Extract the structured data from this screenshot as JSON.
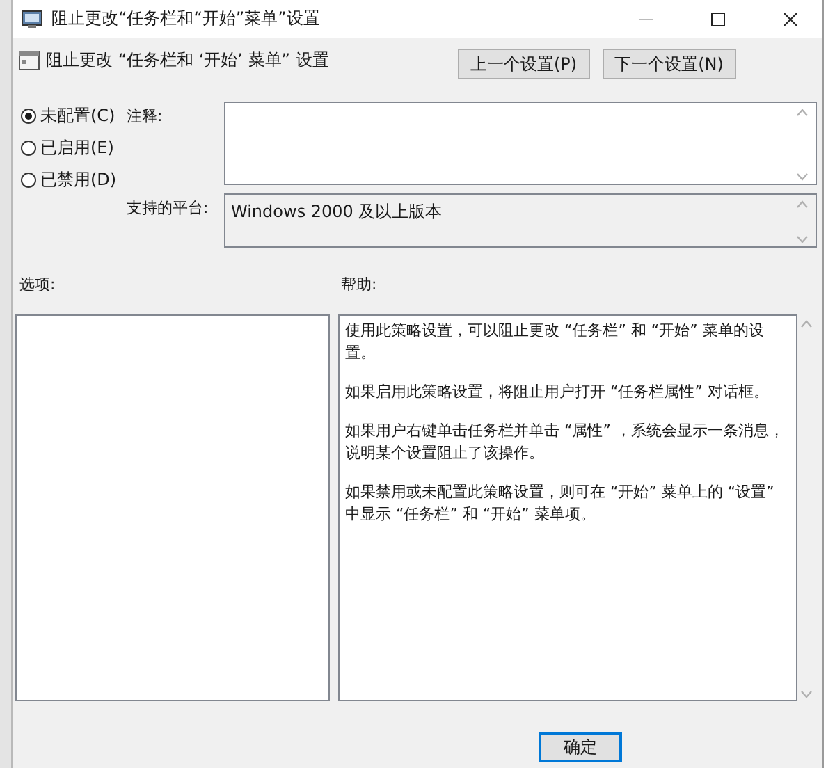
{
  "window": {
    "title": "阻止更改“任务栏和“开始”菜单”设置"
  },
  "header": {
    "policy_name": "阻止更改 “任务栏和 ‘开始’ 菜单” 设置",
    "buttons": [
      {
        "label": "上一个设置(P)"
      },
      {
        "label": "下一个设置(N)"
      }
    ]
  },
  "state_options": [
    {
      "label": "未配置(C)",
      "selected": true
    },
    {
      "label": "已启用(E)",
      "selected": false
    },
    {
      "label": "已禁用(D)",
      "selected": false
    }
  ],
  "comment": {
    "label": "注释:"
  },
  "supported_on": {
    "label": "支持的平台:",
    "value": "Windows 2000 及以上版本"
  },
  "options": {
    "label": "选项:"
  },
  "help": {
    "label": "帮助:",
    "paragraphs": [
      "使用此策略设置，可以阻止更改 “任务栏” 和 “开始” 菜单的设置。",
      "如果启用此策略设置，将阻止用户打开 “任务栏属性” 对话框。",
      "如果用户右键单击任务栏并单击 “属性” ，系统会显示一条消息，说明某个设置阻止了该操作。",
      "如果禁用或未配置此策略设置，则可在 “开始” 菜单上的 “设置” 中显示 “任务栏” 和 “开始” 菜单项。"
    ]
  },
  "footer": {
    "buttons": [
      {
        "label": "确定",
        "focused": true
      }
    ]
  }
}
